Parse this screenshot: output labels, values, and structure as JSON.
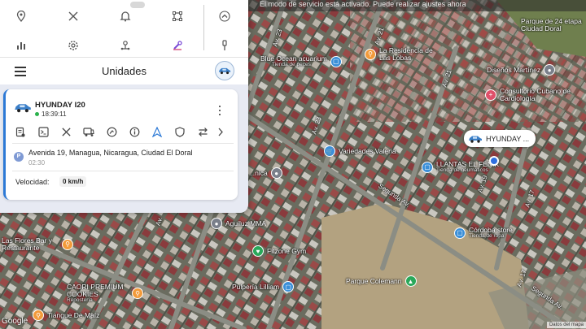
{
  "banner": {
    "text": "El modo de servicio está activado. Puede realizar ajustes ahora"
  },
  "panel": {
    "title": "Unidades",
    "unit": {
      "name": "HYUNDAY I20",
      "last_update": "18:39:11",
      "address": "Avenida 19, Managua, Nicaragua, Ciudad El Doral",
      "address_time": "02:30",
      "address_badge": "P",
      "speed_label": "Velocidad:",
      "speed_value": "0 km/h",
      "status_color": "#2bb24c"
    },
    "toolbar_icons": [
      "location-pin-icon",
      "share-icon",
      "bell-icon",
      "geofence-icon",
      "chevron-up-icon",
      "bar-chart-icon",
      "settings-icon",
      "route-icon",
      "tools-icon",
      "pin-icon"
    ],
    "action_icons": [
      "report-icon",
      "terminal-icon",
      "share-icon",
      "trip-icon",
      "replay-icon",
      "info-icon",
      "navigation-icon",
      "shield-icon",
      "swap-icon",
      "chevron-right-icon"
    ]
  },
  "map": {
    "vehicle_label": "HYUNDAY ...",
    "attribution": "Google",
    "map_data": "Datos del mapa",
    "pois": [
      {
        "name": "Blue Ocean acuarium",
        "sub": "Tienda de peces"
      },
      {
        "name": "La Residencia de Las Lobas",
        "sub": ""
      },
      {
        "name": "Diseños Martínez",
        "sub": ""
      },
      {
        "name": "Consultorio Cubano de Cardiología",
        "sub": ""
      },
      {
        "name": "Parque de 24 etapa Ciudad Doral",
        "sub": ""
      },
      {
        "name": "Variedades Valeria",
        "sub": ""
      },
      {
        "name": "LLANTAS EL FÉNIX",
        "sub": "Tienda de neumáticos"
      },
      {
        "name": "Córdoba store",
        "sub": "Tienda de ropa"
      },
      {
        "name": "Aguiluz MMA",
        "sub": ""
      },
      {
        "name": "Fitzone Gym",
        "sub": ""
      },
      {
        "name": "Las Flores Bar y Restaurante",
        "sub": ""
      },
      {
        "name": "CAORI PREMIUM COOKIES",
        "sub": "Repostería"
      },
      {
        "name": "Pulpería Lilliam",
        "sub": ""
      },
      {
        "name": "Parque Colemann",
        "sub": ""
      },
      {
        "name": "Tiangue De Maíz",
        "sub": ""
      },
      {
        "name": "...nica",
        "sub": ""
      }
    ],
    "streets": [
      "Av. 23",
      "Av. 23",
      "Av. 21",
      "Av. 21",
      "Av. 19",
      "Av. 17",
      "Av. 17",
      "Segunda Av.",
      "Segunda Av.",
      "Av."
    ]
  }
}
